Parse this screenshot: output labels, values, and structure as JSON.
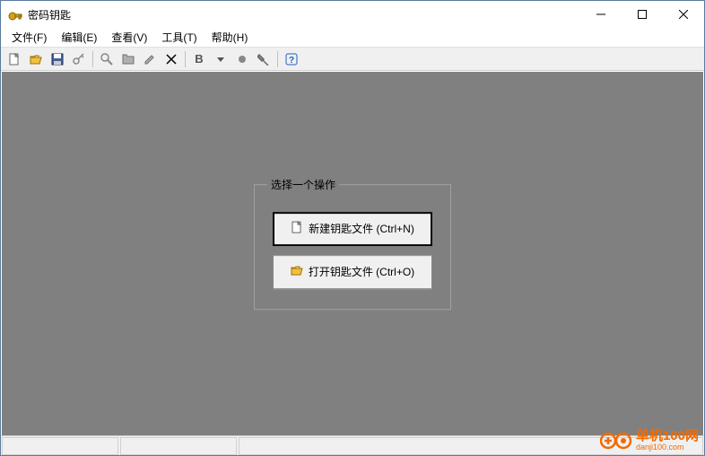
{
  "window": {
    "title": "密码钥匙"
  },
  "menu": {
    "file": "文件(F)",
    "edit": "编辑(E)",
    "view": "查看(V)",
    "tools": "工具(T)",
    "help": "帮助(H)"
  },
  "operation_panel": {
    "legend": "选择一个操作",
    "new_label": "新建钥匙文件 (Ctrl+N)",
    "open_label": "打开钥匙文件 (Ctrl+O)"
  },
  "watermark": {
    "brand": "单机100网",
    "url": "danji100.com"
  }
}
